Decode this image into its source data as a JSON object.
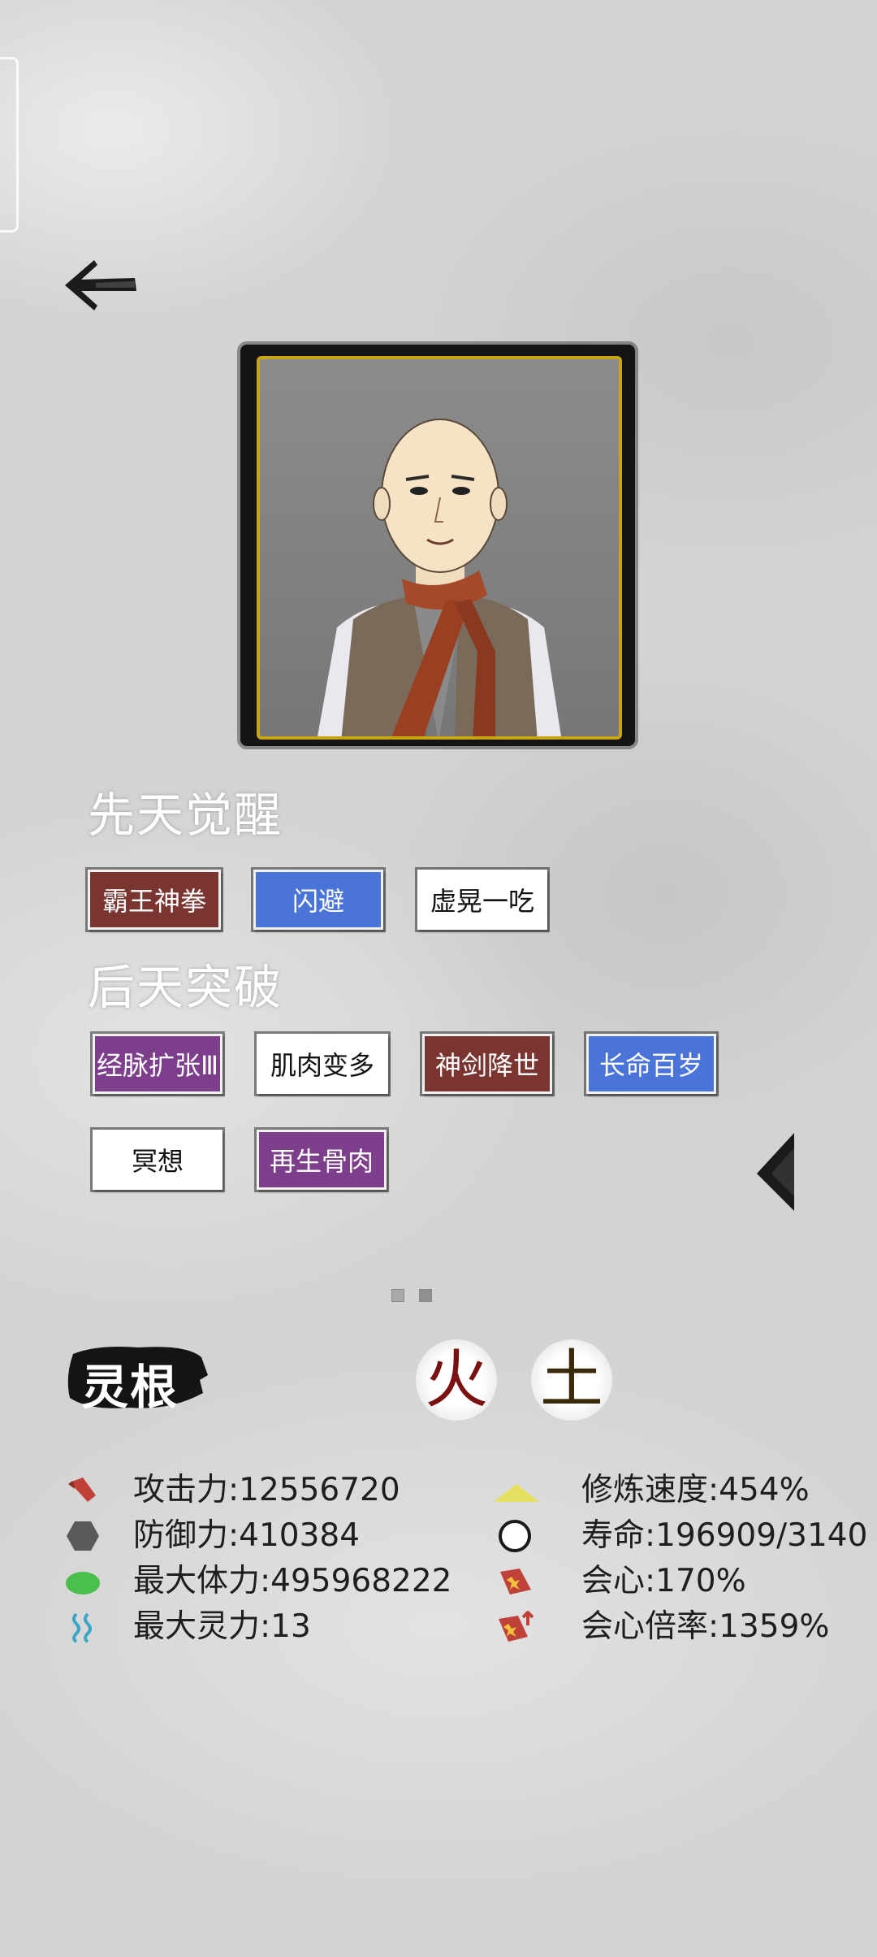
{
  "screen": {
    "innate_title": "先天觉醒",
    "acquired_title": "后天突破",
    "spirit_root_label": "灵根"
  },
  "innate_tags": [
    {
      "label": "霸王神拳",
      "style": "red"
    },
    {
      "label": "闪避",
      "style": "blue"
    },
    {
      "label": "虚晃一吃",
      "style": "white"
    }
  ],
  "acquired_tags": [
    {
      "label": "经脉扩张Ⅲ",
      "style": "purple"
    },
    {
      "label": "肌肉变多",
      "style": "white"
    },
    {
      "label": "神剑降世",
      "style": "red"
    },
    {
      "label": "长命百岁",
      "style": "blue"
    },
    {
      "label": "冥想",
      "style": "white"
    },
    {
      "label": "再生骨肉",
      "style": "purple"
    }
  ],
  "elements": [
    {
      "char": "火",
      "color": "#7a1010"
    },
    {
      "char": "土",
      "color": "#3a2a0a"
    }
  ],
  "pagination": {
    "pages": 2,
    "current": 2
  },
  "stats_left": [
    {
      "icon": "attack-icon",
      "text": "攻击力:12556720"
    },
    {
      "icon": "defense-icon",
      "text": "防御力:410384"
    },
    {
      "icon": "health-icon",
      "text": "最大体力:495968222"
    },
    {
      "icon": "spirit-icon",
      "text": "最大灵力:13"
    }
  ],
  "stats_right": [
    {
      "icon": "cultivation-speed-icon",
      "text": "修炼速度:454%"
    },
    {
      "icon": "lifespan-icon",
      "text": "寿命:196909/3140"
    },
    {
      "icon": "critical-icon",
      "text": "会心:170%"
    },
    {
      "icon": "critical-multiplier-icon",
      "text": "会心倍率:1359%"
    }
  ]
}
